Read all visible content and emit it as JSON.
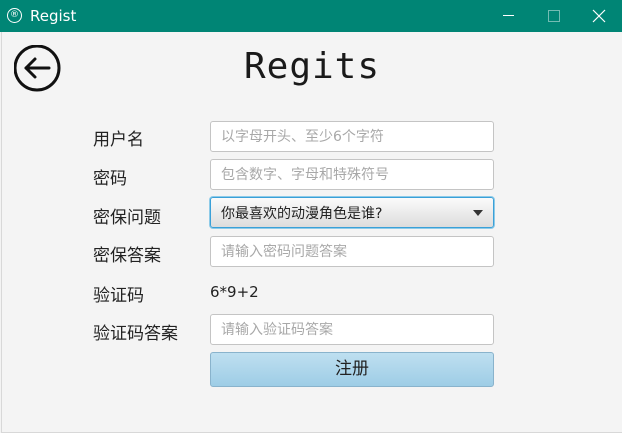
{
  "window": {
    "app_icon_glyph": "®",
    "title": "Regist"
  },
  "page": {
    "title": "Regits"
  },
  "form": {
    "username": {
      "label": "用户名",
      "placeholder": "以字母开头、至少6个字符",
      "value": ""
    },
    "password": {
      "label": "密码",
      "placeholder": "包含数字、字母和特殊符号",
      "value": ""
    },
    "security_question": {
      "label": "密保问题",
      "selected": "你最喜欢的动漫角色是谁?"
    },
    "security_answer": {
      "label": "密保答案",
      "placeholder": "请输入密码问题答案",
      "value": ""
    },
    "captcha": {
      "label": "验证码",
      "value": "6*9+2"
    },
    "captcha_answer": {
      "label": "验证码答案",
      "placeholder": "请输入验证码答案",
      "value": ""
    },
    "submit_label": "注册"
  },
  "icons": {
    "app": "registered-icon",
    "back": "arrow-left-circle-icon",
    "minimize": "minimize-icon",
    "maximize": "maximize-icon",
    "close": "close-icon",
    "dropdown": "chevron-down-icon"
  },
  "colors": {
    "titlebar": "#008575",
    "accent_focus": "#3aa0d8",
    "button": "#a8d4ea"
  }
}
